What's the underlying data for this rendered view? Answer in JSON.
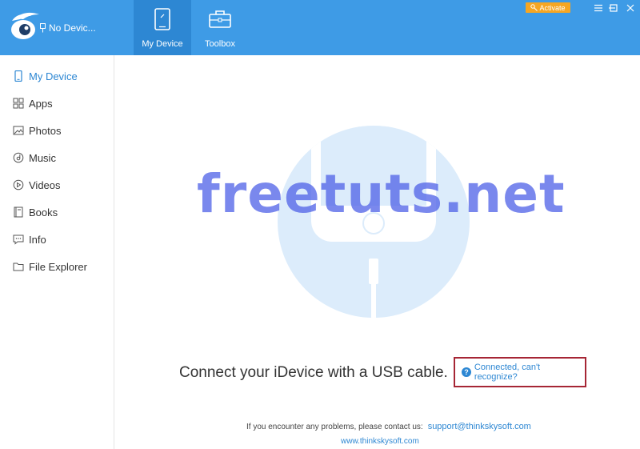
{
  "header": {
    "device_status": "No Devic...",
    "tabs": [
      {
        "label": "My Device",
        "icon": "tablet-icon",
        "active": true
      },
      {
        "label": "Toolbox",
        "icon": "toolbox-icon",
        "active": false
      }
    ],
    "activate_label": "Activate",
    "accent_color": "#3e9be6"
  },
  "sidebar": {
    "items": [
      {
        "label": "My Device",
        "icon": "phone-icon",
        "active": true
      },
      {
        "label": "Apps",
        "icon": "apps-grid-icon"
      },
      {
        "label": "Photos",
        "icon": "image-icon"
      },
      {
        "label": "Music",
        "icon": "music-disc-icon"
      },
      {
        "label": "Videos",
        "icon": "play-icon"
      },
      {
        "label": "Books",
        "icon": "book-icon"
      },
      {
        "label": "Info",
        "icon": "message-icon"
      },
      {
        "label": "File Explorer",
        "icon": "folder-icon"
      }
    ]
  },
  "main": {
    "watermark": "freetuts.net",
    "connect_text": "Connect your iDevice with a USB cable.",
    "help_link": "Connected, can't recognize?",
    "contact_prefix": "If you encounter any problems, please contact us:",
    "contact_email": "support@thinkskysoft.com",
    "website": "www.thinkskysoft.com"
  }
}
